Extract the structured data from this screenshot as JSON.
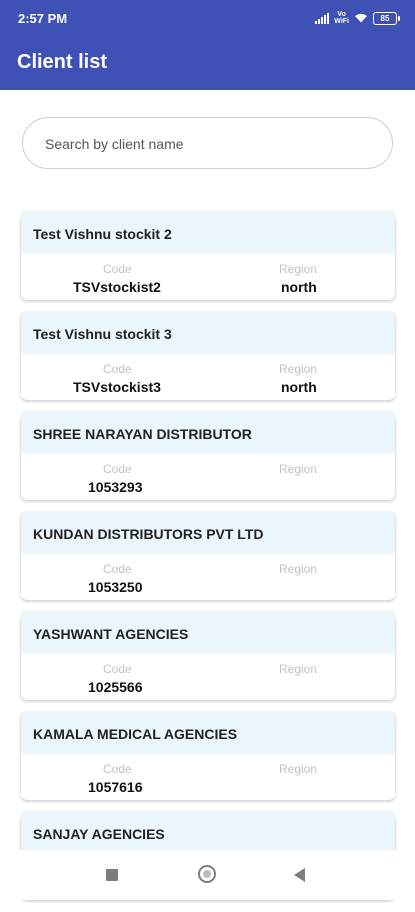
{
  "status_bar": {
    "time": "2:57 PM",
    "volte": "Vo\nWiFi",
    "battery": "85"
  },
  "header": {
    "title": "Client list",
    "color": "#3f51b5"
  },
  "search": {
    "placeholder": "Search by client name",
    "value": ""
  },
  "labels": {
    "code": "Code",
    "region": "Region"
  },
  "clients": [
    {
      "name": "Test Vishnu stockit 2",
      "code": "TSVstockist2",
      "region": "north"
    },
    {
      "name": "Test Vishnu stockit 3",
      "code": "TSVstockist3",
      "region": "north"
    },
    {
      "name": "SHREE NARAYAN DISTRIBUTOR",
      "code": "1053293",
      "region": ""
    },
    {
      "name": "KUNDAN DISTRIBUTORS PVT LTD",
      "code": "1053250",
      "region": ""
    },
    {
      "name": "YASHWANT AGENCIES",
      "code": "1025566",
      "region": ""
    },
    {
      "name": "KAMALA MEDICAL AGENCIES",
      "code": "1057616",
      "region": ""
    },
    {
      "name": "SANJAY AGENCIES",
      "code": "",
      "region": ""
    }
  ],
  "nav": {
    "recents_icon": "square-icon",
    "home_icon": "circle-icon",
    "back_icon": "triangle-back-icon"
  }
}
